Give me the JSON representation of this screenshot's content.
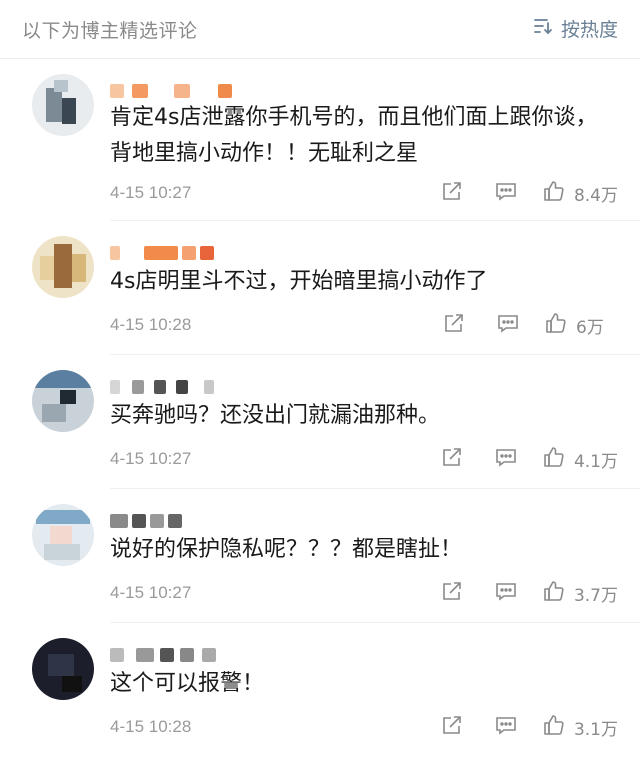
{
  "header": {
    "title": "以下为博主精选评论",
    "sort_label": "按热度",
    "sort_icon": "sort-icon"
  },
  "comments": [
    {
      "text": "肯定4s店泄露你手机号的，而且他们面上跟你谈，背地里搞小动作！！无耻利之星",
      "time": "4-15 10:27",
      "likes": "8.4万"
    },
    {
      "text": "4s店明里斗不过，开始暗里搞小动作了",
      "time": "4-15 10:28",
      "likes": "6万"
    },
    {
      "text": "买奔驰吗？还没出门就漏油那种。",
      "time": "4-15 10:27",
      "likes": "4.1万"
    },
    {
      "text": "说好的保护隐私呢？？？都是瞎扯！",
      "time": "4-15 10:27",
      "likes": "3.7万"
    },
    {
      "text": "这个可以报警！",
      "time": "4-15 10:28",
      "likes": "3.1万"
    }
  ],
  "icons": [
    "share-icon",
    "reply-icon",
    "like-icon",
    "sort-icon"
  ],
  "colors": {
    "accent": "#6a8097",
    "meta": "#9a9a9a",
    "text": "#1a1a1a"
  }
}
